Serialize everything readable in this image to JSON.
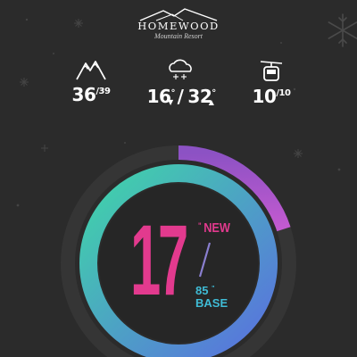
{
  "brand": {
    "name": "HOMEWOOD",
    "tagline": "Mountain Resort"
  },
  "stats": {
    "runs": {
      "icon": "mountain-icon",
      "open": "36",
      "total": "39"
    },
    "temperature": {
      "icon": "snow-cloud-icon",
      "low": "16",
      "high": "32",
      "unit": "°"
    },
    "lifts": {
      "icon": "gondola-icon",
      "open": "10",
      "total": "10"
    }
  },
  "snow": {
    "new_amount": "17",
    "new_unit": "\"",
    "new_label": "NEW",
    "base_amount": "85",
    "base_unit": "\"",
    "base_label": "BASE",
    "new_fraction": 0.2,
    "base_fraction": 1.0
  },
  "colors": {
    "background": "#2b2b2b",
    "new_snow": "#e23a8e",
    "base_start": "#3fd6a8",
    "base_end": "#5a6fe0",
    "new_arc": "#a857c8"
  }
}
